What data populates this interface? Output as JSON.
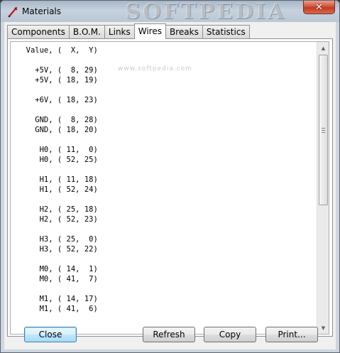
{
  "window": {
    "title": "Materials",
    "watermark": "SOFTPEDIA",
    "close_glyph": "✕",
    "icon": "red-probe-icon"
  },
  "tabs": [
    {
      "label": "Components",
      "active": false
    },
    {
      "label": "B.O.M.",
      "active": false
    },
    {
      "label": "Links",
      "active": false
    },
    {
      "label": "Wires",
      "active": true
    },
    {
      "label": "Breaks",
      "active": false
    },
    {
      "label": "Statistics",
      "active": false
    }
  ],
  "listing": {
    "watermark": "www.softpedia.com",
    "lines": [
      "  Value, (  X,  Y)",
      "",
      "    +5V, (  8, 29)",
      "    +5V, ( 18, 19)",
      "",
      "    +6V, ( 18, 23)",
      "",
      "    GND, (  8, 28)",
      "    GND, ( 18, 20)",
      "",
      "     H0, ( 11,  0)",
      "     H0, ( 52, 25)",
      "",
      "     H1, ( 11, 18)",
      "     H1, ( 52, 24)",
      "",
      "     H2, ( 25, 18)",
      "     H2, ( 52, 23)",
      "",
      "     H3, ( 25,  0)",
      "     H3, ( 52, 22)",
      "",
      "     M0, ( 14,  1)",
      "     M0, ( 41,  7)",
      "",
      "     M1, ( 14, 17)",
      "     M1, ( 41,  6)"
    ]
  },
  "scrollbar": {
    "up_arrow": "▲",
    "down_arrow": "▼"
  },
  "buttons": {
    "close": "Close",
    "refresh": "Refresh",
    "copy": "Copy",
    "print": "Print..."
  },
  "colors": {
    "default_button_border": "#3c7fb1",
    "close_button_red": "#c23a22"
  }
}
